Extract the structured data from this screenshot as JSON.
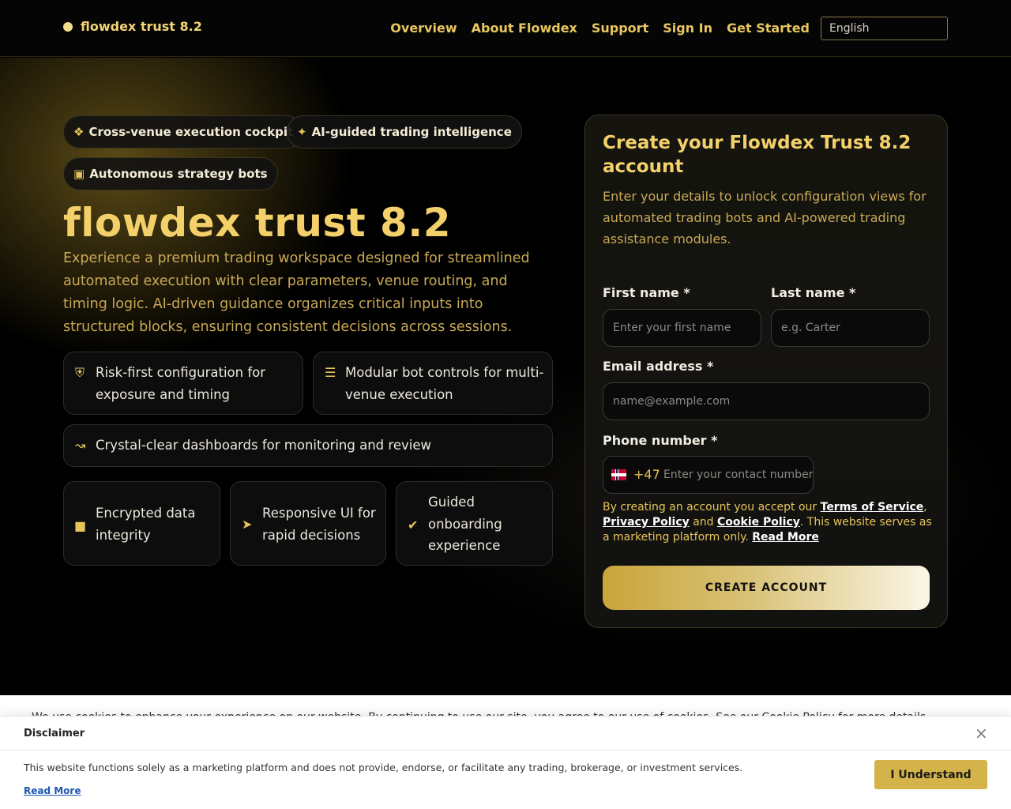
{
  "header": {
    "brand": "flowdex trust 8.2",
    "nav": [
      "Overview",
      "About Flowdex",
      "Support",
      "Sign In",
      "Get Started"
    ],
    "language": "English"
  },
  "hero": {
    "pills": [
      {
        "icon": "network-icon",
        "label": "Cross-venue execution cockpit"
      },
      {
        "icon": "magic-wand-icon",
        "label": "AI-guided trading intelligence"
      },
      {
        "icon": "robot-icon",
        "label": "Autonomous strategy bots"
      }
    ],
    "title": "flowdex trust 8.2",
    "description": "Experience a premium trading workspace designed for streamlined automated execution with clear parameters, venue routing, and timing logic. AI-driven guidance organizes critical inputs into structured blocks, ensuring consistent decisions across sessions.",
    "features": [
      {
        "icon": "shield-icon",
        "text": "Risk-first configuration for exposure and timing"
      },
      {
        "icon": "sliders-icon",
        "text": "Modular bot controls for multi-venue execution"
      },
      {
        "icon": "chart-line-icon",
        "text": "Crystal-clear dashboards for monitoring and review"
      }
    ],
    "badges": [
      {
        "icon": "lock-icon",
        "text": "Encrypted data integrity"
      },
      {
        "icon": "bolt-icon",
        "text": "Responsive UI for rapid decisions"
      },
      {
        "icon": "check-circle-icon",
        "text": "Guided onboarding experience"
      }
    ]
  },
  "form": {
    "title": "Create your Flowdex Trust 8.2 account",
    "description": "Enter your details to unlock configuration views for automated trading bots and AI-powered trading assistance modules.",
    "first_name_label": "First name *",
    "first_name_placeholder": "Enter your first name",
    "last_name_label": "Last name *",
    "last_name_placeholder": "e.g. Carter",
    "email_label": "Email address *",
    "email_placeholder": "name@example.com",
    "phone_label": "Phone number *",
    "phone_code": "+47",
    "phone_placeholder": "Enter your contact number",
    "terms_prefix": "By creating an account you accept our ",
    "terms_link": "Terms of Service",
    "terms_comma": ",",
    "privacy_link": "Privacy Policy",
    "terms_and": " and ",
    "cookie_link": "Cookie Policy",
    "terms_suffix": ". This website serves as a marketing platform only. ",
    "read_more": "Read More",
    "submit": "CREATE ACCOUNT"
  },
  "cookie_strip": {
    "text": "We use cookies to enhance your experience on our website. By continuing to use our site, you agree to our use of cookies. See our Cookie Policy for more details."
  },
  "disclaimer": {
    "title": "Disclaimer",
    "close": "×",
    "text": "This website functions solely as a marketing platform and does not provide, endorse, or facilitate any trading, brokerage, or investment services.",
    "read_more": "Read More",
    "button": "I Understand"
  },
  "colors": {
    "accent": "#f3d06a",
    "gold_text": "#c9a955",
    "background": "#000000"
  }
}
